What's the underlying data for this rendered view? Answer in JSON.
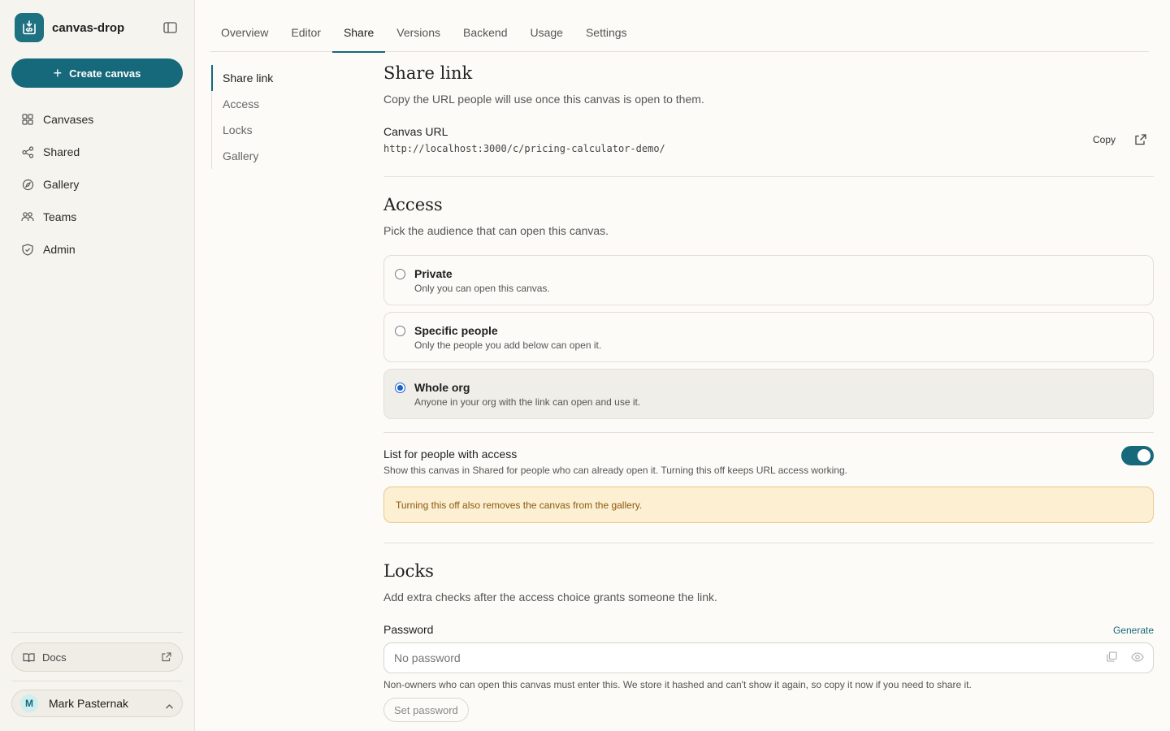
{
  "app": {
    "name": "canvas-drop"
  },
  "sidebar": {
    "create_label": "Create canvas",
    "items": [
      {
        "label": "Canvases",
        "icon": "grid-icon"
      },
      {
        "label": "Shared",
        "icon": "share-icon"
      },
      {
        "label": "Gallery",
        "icon": "compass-icon"
      },
      {
        "label": "Teams",
        "icon": "users-icon"
      },
      {
        "label": "Admin",
        "icon": "shield-icon"
      }
    ],
    "docs_label": "Docs",
    "user": {
      "initial": "M",
      "name": "Mark Pasternak"
    }
  },
  "tabs": [
    {
      "label": "Overview"
    },
    {
      "label": "Editor"
    },
    {
      "label": "Share",
      "active": true
    },
    {
      "label": "Versions"
    },
    {
      "label": "Backend"
    },
    {
      "label": "Usage"
    },
    {
      "label": "Settings"
    }
  ],
  "subnav": [
    {
      "label": "Share link",
      "active": true
    },
    {
      "label": "Access"
    },
    {
      "label": "Locks"
    },
    {
      "label": "Gallery"
    }
  ],
  "share_link": {
    "title": "Share link",
    "description": "Copy the URL people will use once this canvas is open to them.",
    "url_label": "Canvas URL",
    "url": "http://localhost:3000/c/pricing-calculator-demo/",
    "copy_label": "Copy"
  },
  "access": {
    "title": "Access",
    "description": "Pick the audience that can open this canvas.",
    "options": [
      {
        "title": "Private",
        "description": "Only you can open this canvas.",
        "selected": false
      },
      {
        "title": "Specific people",
        "description": "Only the people you add below can open it.",
        "selected": false
      },
      {
        "title": "Whole org",
        "description": "Anyone in your org with the link can open and use it.",
        "selected": true
      }
    ],
    "list_title": "List for people with access",
    "list_description": "Show this canvas in Shared for people who can already open it. Turning this off keeps URL access working.",
    "list_enabled": true,
    "warning": "Turning this off also removes the canvas from the gallery."
  },
  "locks": {
    "title": "Locks",
    "description": "Add extra checks after the access choice grants someone the link.",
    "password_label": "Password",
    "generate_label": "Generate",
    "password_placeholder": "No password",
    "password_help": "Non-owners who can open this canvas must enter this. We store it hashed and can't show it again, so copy it now if you need to share it.",
    "set_password_label": "Set password"
  },
  "colors": {
    "accent": "#16697a",
    "selected_radio": "#1a5fd6",
    "warning_bg": "#fcefd2",
    "warning_text": "#8a5a10"
  }
}
